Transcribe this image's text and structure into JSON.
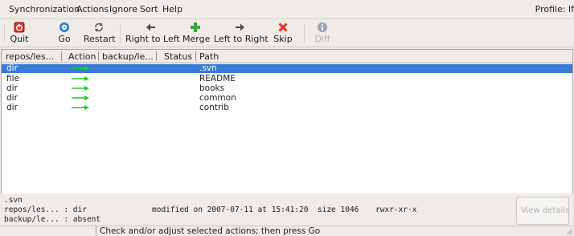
{
  "menubar": {
    "items": [
      "Synchronization",
      "Actions",
      "Ignore",
      "Sort",
      "Help"
    ],
    "profile": "Profile: lf"
  },
  "toolbar": {
    "quit": "Quit",
    "go": "Go",
    "restart": "Restart",
    "right_to_left": "Right to Left",
    "merge": "Merge",
    "left_to_right": "Left to Right",
    "skip": "Skip",
    "diff": "Diff"
  },
  "columns": [
    "repos/les...",
    "Action",
    "backup/le...",
    "Status",
    "Path"
  ],
  "rows": [
    {
      "type": "dir",
      "action": "right-arrow",
      "path": ".svn",
      "selected": true
    },
    {
      "type": "file",
      "action": "right-arrow",
      "path": "README",
      "selected": false
    },
    {
      "type": "dir",
      "action": "right-arrow",
      "path": "books",
      "selected": false
    },
    {
      "type": "dir",
      "action": "right-arrow",
      "path": "common",
      "selected": false
    },
    {
      "type": "dir",
      "action": "right-arrow",
      "path": "contrib",
      "selected": false
    }
  ],
  "details": {
    "name": ".svn",
    "line1_label": "repos/les... : dir",
    "line1_info": "modified on 2007-07-11 at 15:41:20  size 1046",
    "line1_perms": "rwxr-xr-x",
    "line2": "backup/le... : absent",
    "view_details": "View details..."
  },
  "status": {
    "message": "Check and/or adjust selected actions; then press Go"
  },
  "colors": {
    "selection": "#3a7bd5",
    "arrow_green": "#22cc22",
    "quit_red": "#d9302c",
    "go_blue": "#2f7fd0",
    "skip_red": "#e0301e",
    "merge_green": "#38a83a"
  }
}
